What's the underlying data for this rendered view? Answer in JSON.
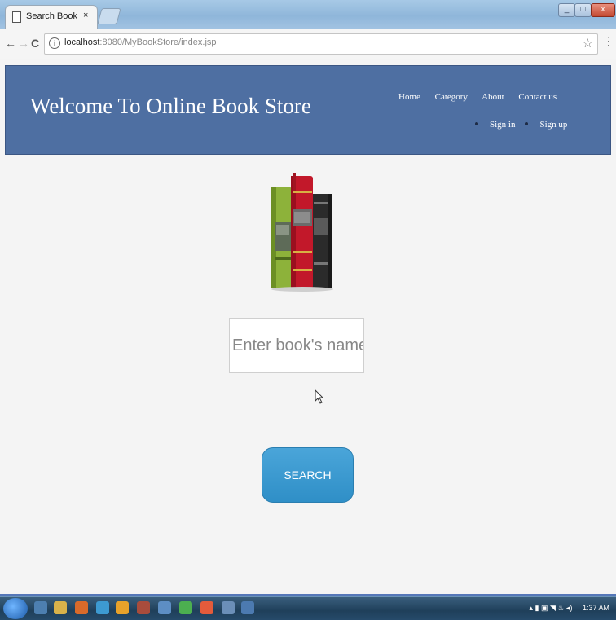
{
  "browser": {
    "tab_title": "Search Book",
    "tab_close": "×",
    "url_host": "localhost",
    "url_rest": ":8080/MyBookStore/index.jsp",
    "back": "←",
    "forward": "→",
    "reload": "C",
    "star": "☆",
    "menu": "⋮"
  },
  "site": {
    "brand": "Welcome To Online Book Store",
    "nav": [
      "Home",
      "Category",
      "About",
      "Contact us"
    ],
    "auth": [
      "Sign in",
      "Sign up"
    ]
  },
  "search": {
    "placeholder": "Enter book's name...",
    "button": "SEARCH"
  },
  "taskbar": {
    "clock": "1:37 AM"
  },
  "colors": {
    "header": "#4e6fa2",
    "button": "#2f8fc7"
  }
}
